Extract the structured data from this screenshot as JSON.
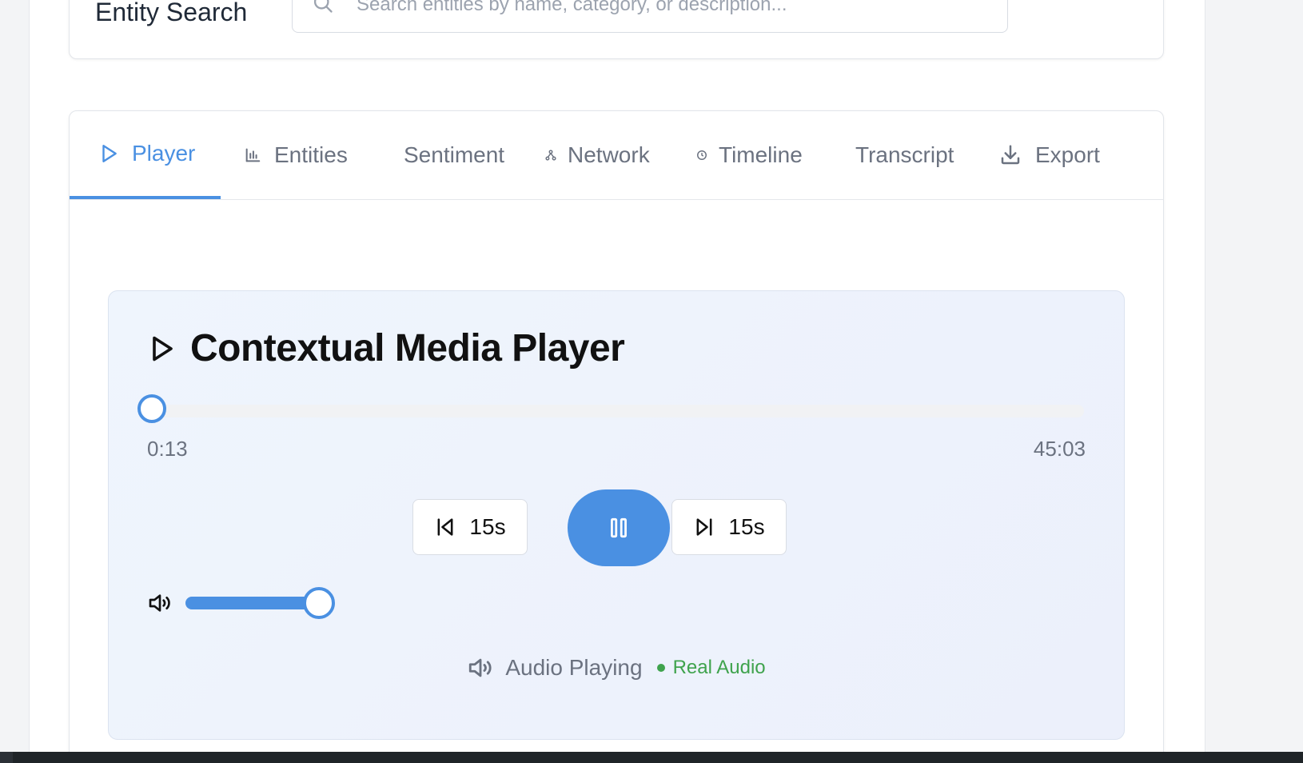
{
  "search": {
    "title": "Entity Search",
    "placeholder": "Search entities by name, category, or description...",
    "value": ""
  },
  "tabs": [
    {
      "label": "Player",
      "icon": "play-icon",
      "active": true
    },
    {
      "label": "Entities",
      "icon": "bar-chart-icon",
      "active": false
    },
    {
      "label": "Sentiment",
      "icon": "",
      "active": false
    },
    {
      "label": "Network",
      "icon": "network-icon",
      "active": false
    },
    {
      "label": "Timeline",
      "icon": "clock-icon",
      "active": false
    },
    {
      "label": "Transcript",
      "icon": "",
      "active": false
    },
    {
      "label": "Export",
      "icon": "download-icon",
      "active": false
    }
  ],
  "player": {
    "title": "Contextual Media Player",
    "current_time": "0:13",
    "total_time": "45:03",
    "progress_fraction": 0.005,
    "skip_back_label": "15s",
    "skip_forward_label": "15s",
    "state": "playing",
    "volume_fraction": 0.97,
    "status_text": "Audio Playing",
    "badge_text": "Real Audio"
  },
  "colors": {
    "accent": "#4a90e2",
    "badge_green": "#3fa34d",
    "panel_bg": "#eff5fd"
  }
}
